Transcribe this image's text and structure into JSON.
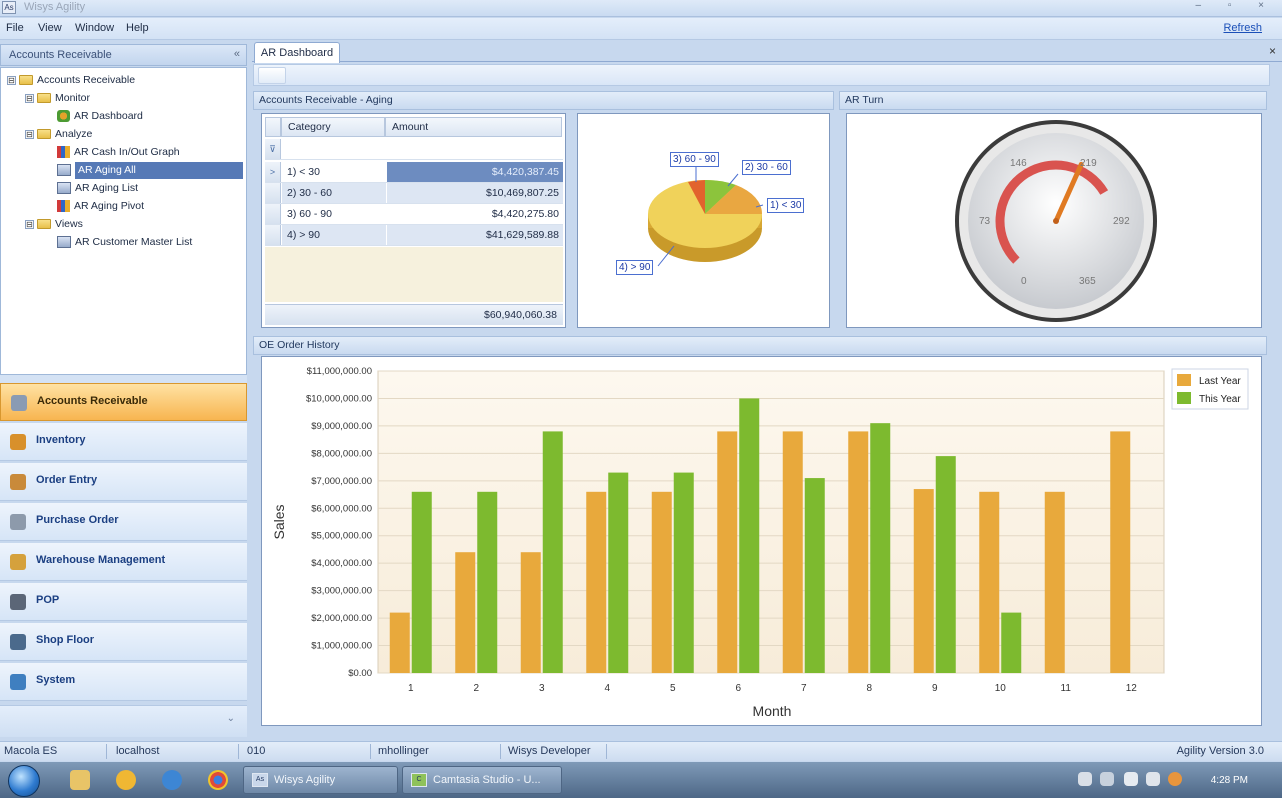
{
  "window": {
    "title": "Wisys Agility",
    "icon_text": "As",
    "controls": "– ▫ ×"
  },
  "menu": {
    "items": [
      "File",
      "View",
      "Window",
      "Help"
    ],
    "refresh": "Refresh"
  },
  "nav": {
    "header": "Accounts Receivable",
    "close": "«",
    "tree": [
      {
        "label": "Accounts Receivable",
        "toggle": "⊟"
      },
      {
        "label": "Monitor",
        "toggle": "⊟"
      },
      {
        "label": "AR Dashboard"
      },
      {
        "label": "Analyze",
        "toggle": "⊟"
      },
      {
        "label": "AR Cash In/Out Graph"
      },
      {
        "label": "AR Aging All"
      },
      {
        "label": "AR Aging List"
      },
      {
        "label": "AR Aging Pivot"
      },
      {
        "label": "Views",
        "toggle": "⊟"
      },
      {
        "label": "AR Customer Master List"
      }
    ],
    "buttons": [
      {
        "label": "Accounts Receivable",
        "icon": "ar-icon",
        "color": "#8a9bb3"
      },
      {
        "label": "Inventory",
        "icon": "inventory-icon",
        "color": "#d8902b"
      },
      {
        "label": "Order Entry",
        "icon": "order-entry-icon",
        "color": "#c98a3a"
      },
      {
        "label": "Purchase Order",
        "icon": "purchase-order-icon",
        "color": "#8d9aab"
      },
      {
        "label": "Warehouse Management",
        "icon": "warehouse-icon",
        "color": "#d5a13c"
      },
      {
        "label": "POP",
        "icon": "pop-icon",
        "color": "#5b6677"
      },
      {
        "label": "Shop Floor",
        "icon": "shop-floor-icon",
        "color": "#4b6a8c"
      },
      {
        "label": "System",
        "icon": "system-icon",
        "color": "#3f7fc0"
      }
    ],
    "footer_chevron": "⌄"
  },
  "tabs": {
    "active": "AR Dashboard",
    "close": "×"
  },
  "panels": {
    "aging_title": "Accounts Receivable - Aging",
    "turn_title": "AR Turn",
    "order_title": "OE Order History"
  },
  "aging_grid": {
    "headers": [
      "Category",
      "Amount"
    ],
    "filter_icon": "⊽",
    "rows": [
      {
        "category": "1) < 30",
        "amount": "$4,420,387.45"
      },
      {
        "category": "2) 30 - 60",
        "amount": "$10,469,807.25"
      },
      {
        "category": "3) 60 - 90",
        "amount": "$4,420,275.80"
      },
      {
        "category": "4) > 90",
        "amount": "$41,629,589.88"
      }
    ],
    "row_indicator": ">",
    "total": "$60,940,060.38"
  },
  "pie": {
    "labels": [
      "3) 60 - 90",
      "2) 30 - 60",
      "1) < 30",
      "4) > 90"
    ],
    "colors": {
      "lt30": "#e9a741",
      "30_60": "#8cc43c",
      "60_90": "#e2632d",
      "gt90": "#f0d25a"
    }
  },
  "gauge": {
    "ticks": [
      "0",
      "73",
      "146",
      "219",
      "292",
      "365"
    ],
    "value": 215,
    "max": 365,
    "range_color": "#d9534f",
    "needle_color": "#e07a22"
  },
  "chart_data": {
    "type": "bar",
    "categories": [
      "1",
      "2",
      "3",
      "4",
      "5",
      "6",
      "7",
      "8",
      "9",
      "10",
      "11",
      "12"
    ],
    "series": [
      {
        "name": "Last Year",
        "color": "#e8a93c",
        "values": [
          2200000,
          4400000,
          4400000,
          6600000,
          6600000,
          8800000,
          8800000,
          8800000,
          6700000,
          6600000,
          6600000,
          8800000
        ]
      },
      {
        "name": "This Year",
        "color": "#7dba2f",
        "values": [
          6600000,
          6600000,
          8800000,
          7300000,
          7300000,
          10000000,
          7100000,
          9100000,
          7900000,
          2200000,
          null,
          null
        ]
      }
    ],
    "yticks": [
      "$0.00",
      "$1,000,000.00",
      "$2,000,000.00",
      "$3,000,000.00",
      "$4,000,000.00",
      "$5,000,000.00",
      "$6,000,000.00",
      "$7,000,000.00",
      "$8,000,000.00",
      "$9,000,000.00",
      "$10,000,000.00",
      "$11,000,000.00"
    ],
    "ylim": [
      0,
      11000000
    ],
    "xlabel": "Month",
    "ylabel": "Sales",
    "legend": "top-right",
    "grid": true
  },
  "status": {
    "items": [
      "Macola ES",
      "localhost",
      "010",
      "mhollinger",
      "Wisys Developer"
    ],
    "version": "Agility Version 3.0"
  },
  "taskbar": {
    "tasks": [
      {
        "label": "Wisys Agility",
        "icon_text": "As"
      },
      {
        "label": "Camtasia Studio - U...",
        "icon_text": "C"
      }
    ],
    "clock": "4:28 PM"
  }
}
